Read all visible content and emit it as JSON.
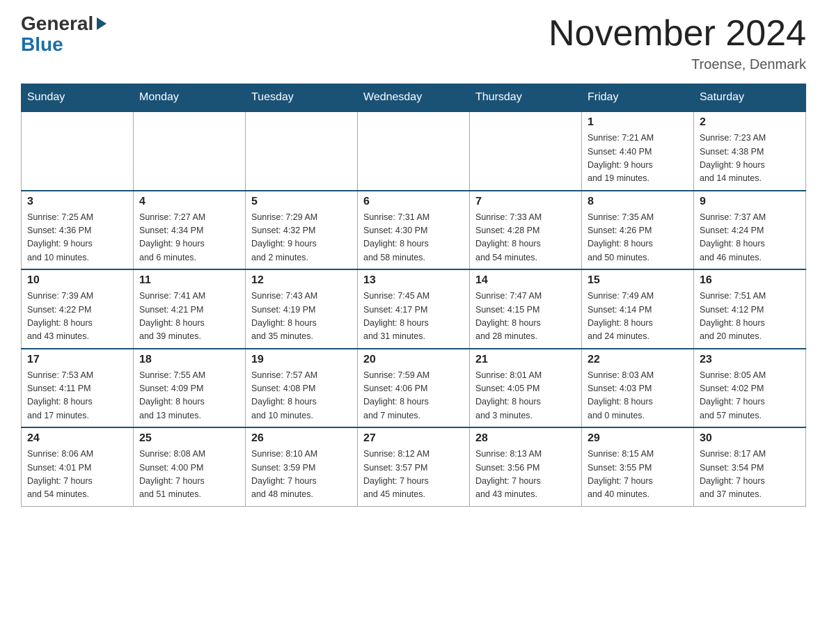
{
  "header": {
    "logo_general": "General",
    "logo_blue": "Blue",
    "month_title": "November 2024",
    "location": "Troense, Denmark"
  },
  "days_of_week": [
    "Sunday",
    "Monday",
    "Tuesday",
    "Wednesday",
    "Thursday",
    "Friday",
    "Saturday"
  ],
  "weeks": [
    [
      {
        "day": "",
        "info": ""
      },
      {
        "day": "",
        "info": ""
      },
      {
        "day": "",
        "info": ""
      },
      {
        "day": "",
        "info": ""
      },
      {
        "day": "",
        "info": ""
      },
      {
        "day": "1",
        "info": "Sunrise: 7:21 AM\nSunset: 4:40 PM\nDaylight: 9 hours\nand 19 minutes."
      },
      {
        "day": "2",
        "info": "Sunrise: 7:23 AM\nSunset: 4:38 PM\nDaylight: 9 hours\nand 14 minutes."
      }
    ],
    [
      {
        "day": "3",
        "info": "Sunrise: 7:25 AM\nSunset: 4:36 PM\nDaylight: 9 hours\nand 10 minutes."
      },
      {
        "day": "4",
        "info": "Sunrise: 7:27 AM\nSunset: 4:34 PM\nDaylight: 9 hours\nand 6 minutes."
      },
      {
        "day": "5",
        "info": "Sunrise: 7:29 AM\nSunset: 4:32 PM\nDaylight: 9 hours\nand 2 minutes."
      },
      {
        "day": "6",
        "info": "Sunrise: 7:31 AM\nSunset: 4:30 PM\nDaylight: 8 hours\nand 58 minutes."
      },
      {
        "day": "7",
        "info": "Sunrise: 7:33 AM\nSunset: 4:28 PM\nDaylight: 8 hours\nand 54 minutes."
      },
      {
        "day": "8",
        "info": "Sunrise: 7:35 AM\nSunset: 4:26 PM\nDaylight: 8 hours\nand 50 minutes."
      },
      {
        "day": "9",
        "info": "Sunrise: 7:37 AM\nSunset: 4:24 PM\nDaylight: 8 hours\nand 46 minutes."
      }
    ],
    [
      {
        "day": "10",
        "info": "Sunrise: 7:39 AM\nSunset: 4:22 PM\nDaylight: 8 hours\nand 43 minutes."
      },
      {
        "day": "11",
        "info": "Sunrise: 7:41 AM\nSunset: 4:21 PM\nDaylight: 8 hours\nand 39 minutes."
      },
      {
        "day": "12",
        "info": "Sunrise: 7:43 AM\nSunset: 4:19 PM\nDaylight: 8 hours\nand 35 minutes."
      },
      {
        "day": "13",
        "info": "Sunrise: 7:45 AM\nSunset: 4:17 PM\nDaylight: 8 hours\nand 31 minutes."
      },
      {
        "day": "14",
        "info": "Sunrise: 7:47 AM\nSunset: 4:15 PM\nDaylight: 8 hours\nand 28 minutes."
      },
      {
        "day": "15",
        "info": "Sunrise: 7:49 AM\nSunset: 4:14 PM\nDaylight: 8 hours\nand 24 minutes."
      },
      {
        "day": "16",
        "info": "Sunrise: 7:51 AM\nSunset: 4:12 PM\nDaylight: 8 hours\nand 20 minutes."
      }
    ],
    [
      {
        "day": "17",
        "info": "Sunrise: 7:53 AM\nSunset: 4:11 PM\nDaylight: 8 hours\nand 17 minutes."
      },
      {
        "day": "18",
        "info": "Sunrise: 7:55 AM\nSunset: 4:09 PM\nDaylight: 8 hours\nand 13 minutes."
      },
      {
        "day": "19",
        "info": "Sunrise: 7:57 AM\nSunset: 4:08 PM\nDaylight: 8 hours\nand 10 minutes."
      },
      {
        "day": "20",
        "info": "Sunrise: 7:59 AM\nSunset: 4:06 PM\nDaylight: 8 hours\nand 7 minutes."
      },
      {
        "day": "21",
        "info": "Sunrise: 8:01 AM\nSunset: 4:05 PM\nDaylight: 8 hours\nand 3 minutes."
      },
      {
        "day": "22",
        "info": "Sunrise: 8:03 AM\nSunset: 4:03 PM\nDaylight: 8 hours\nand 0 minutes."
      },
      {
        "day": "23",
        "info": "Sunrise: 8:05 AM\nSunset: 4:02 PM\nDaylight: 7 hours\nand 57 minutes."
      }
    ],
    [
      {
        "day": "24",
        "info": "Sunrise: 8:06 AM\nSunset: 4:01 PM\nDaylight: 7 hours\nand 54 minutes."
      },
      {
        "day": "25",
        "info": "Sunrise: 8:08 AM\nSunset: 4:00 PM\nDaylight: 7 hours\nand 51 minutes."
      },
      {
        "day": "26",
        "info": "Sunrise: 8:10 AM\nSunset: 3:59 PM\nDaylight: 7 hours\nand 48 minutes."
      },
      {
        "day": "27",
        "info": "Sunrise: 8:12 AM\nSunset: 3:57 PM\nDaylight: 7 hours\nand 45 minutes."
      },
      {
        "day": "28",
        "info": "Sunrise: 8:13 AM\nSunset: 3:56 PM\nDaylight: 7 hours\nand 43 minutes."
      },
      {
        "day": "29",
        "info": "Sunrise: 8:15 AM\nSunset: 3:55 PM\nDaylight: 7 hours\nand 40 minutes."
      },
      {
        "day": "30",
        "info": "Sunrise: 8:17 AM\nSunset: 3:54 PM\nDaylight: 7 hours\nand 37 minutes."
      }
    ]
  ]
}
